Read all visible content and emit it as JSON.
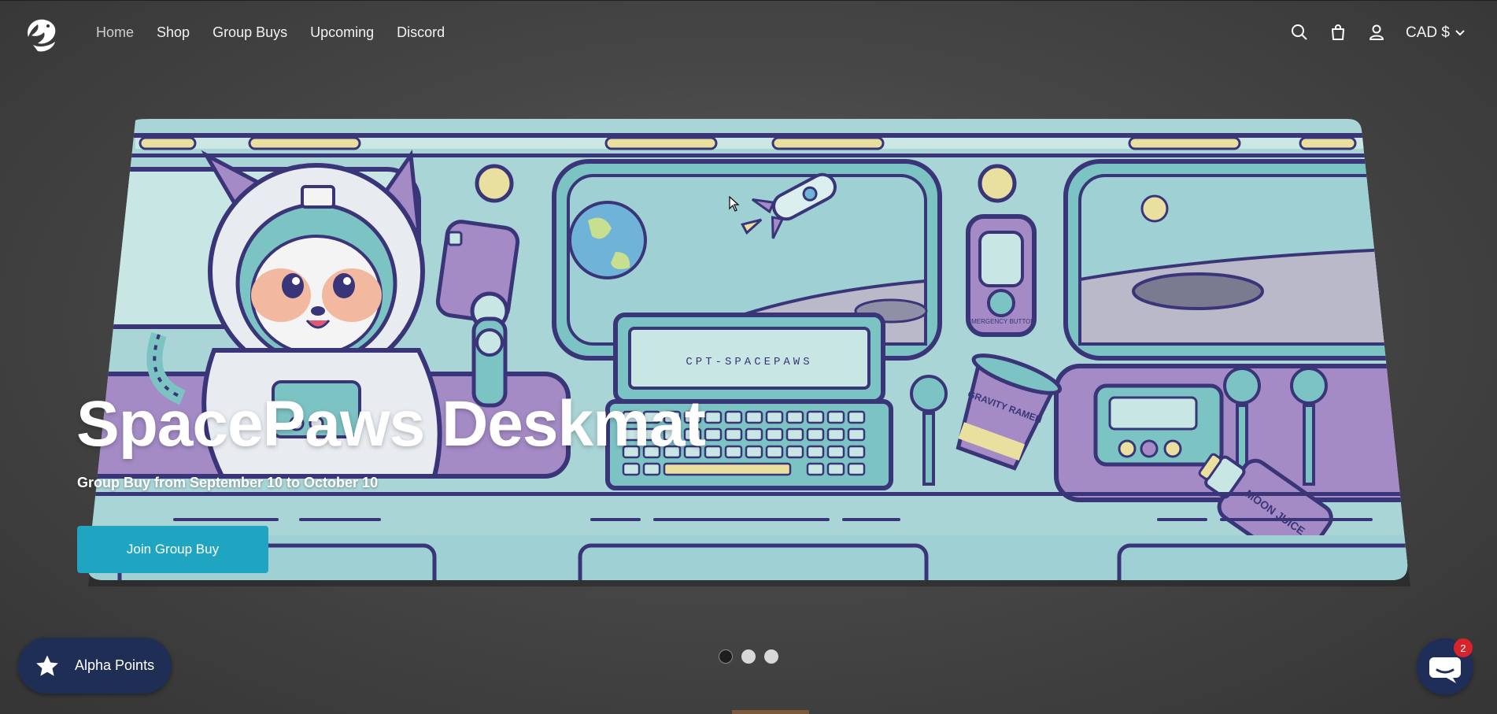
{
  "nav": {
    "items": [
      "Home",
      "Shop",
      "Group Buys",
      "Upcoming",
      "Discord"
    ],
    "active": "Home"
  },
  "header": {
    "currency": "CAD $",
    "icons": [
      "search-icon",
      "cart-icon",
      "account-icon"
    ]
  },
  "hero": {
    "title": "SpacePaws Deskmat",
    "subtitle": "Group Buy from September 10 to October 10",
    "cta_label": "Join Group Buy",
    "mat_screen_text": "CPT-SPACEPAWS",
    "button_label": "EMERGENCY BUTTON",
    "cup_text": "GRAVITY RAMEN",
    "bottle_text": "MOON JUICE"
  },
  "slider": {
    "slides": 3,
    "active_index": 0
  },
  "rewards": {
    "label": "Alpha Points"
  },
  "chat": {
    "badge_count": "2"
  },
  "colors": {
    "accent": "#1fa5c1",
    "mat_base": "#a9d5d6",
    "mat_purple": "#a48bc6",
    "outline": "#3a3578",
    "rewards_bg": "#1f2e55"
  }
}
